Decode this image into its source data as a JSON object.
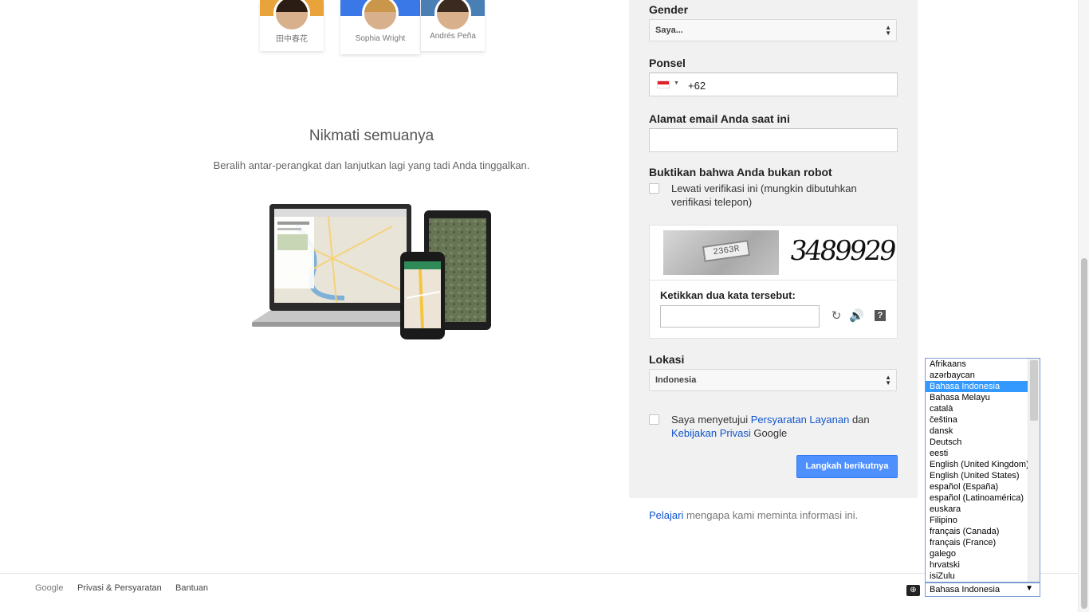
{
  "promo": {
    "people": [
      {
        "name": "田中春花",
        "band": "#e8a33a",
        "hair": "#2b1d14"
      },
      {
        "name": "Sophia Wright",
        "band": "#3b78e7",
        "hair": "#c9964a"
      },
      {
        "name": "Andrés Peña",
        "band": "#4a7fb5",
        "hair": "#3a2a1f"
      }
    ],
    "title": "Nikmati semuanya",
    "subtitle": "Beralih antar-perangkat dan lanjutkan lagi yang tadi Anda tinggalkan."
  },
  "form": {
    "gender_label": "Gender",
    "gender_value": "Saya...",
    "phone_label": "Ponsel",
    "phone_code": "+62",
    "email_label": "Alamat email Anda saat ini",
    "email_value": "",
    "robot_label": "Buktikan bahwa Anda bukan robot",
    "skip_verification": "Lewati verifikasi ini (mungkin dibutuhkan verifikasi telepon)",
    "captcha": {
      "image_text": "3489929",
      "photo_text": "2363R",
      "prompt": "Ketikkan dua kata tersebut:",
      "answer": ""
    },
    "location_label": "Lokasi",
    "location_value": "Indonesia",
    "agree_prefix": "Saya menyetujui ",
    "terms_link": "Persyaratan Layanan",
    "agree_and": " dan ",
    "privacy_link": "Kebijakan Privasi",
    "agree_suffix": " Google",
    "next_button": "Langkah berikutnya",
    "learn_link": "Pelajari",
    "learn_text": " mengapa kami meminta informasi ini."
  },
  "footer": {
    "google": "Google",
    "privacy_terms": "Privasi & Persyaratan",
    "help": "Bantuan"
  },
  "language": {
    "selected": "Bahasa Indonesia",
    "options": [
      "Afrikaans",
      "azərbaycan",
      "Bahasa Indonesia",
      "Bahasa Melayu",
      "català",
      "čeština",
      "dansk",
      "Deutsch",
      "eesti",
      "English (United Kingdom)",
      "English (United States)",
      "español (España)",
      "español (Latinoamérica)",
      "euskara",
      "Filipino",
      "français (Canada)",
      "français (France)",
      "galego",
      "hrvatski",
      "isiZulu"
    ]
  },
  "colors": {
    "accent": "#4d90fe",
    "link": "#1155cc",
    "panel": "#f1f1f1",
    "selection": "#3399ff"
  }
}
